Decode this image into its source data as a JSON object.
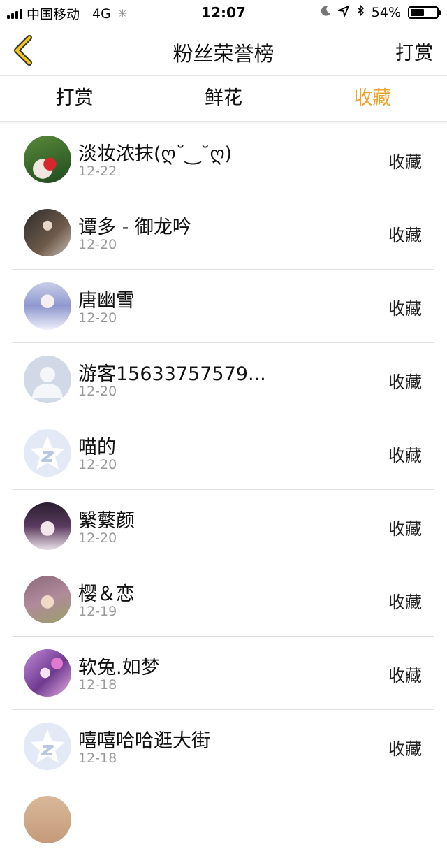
{
  "status_bar": {
    "carrier": "中国移动",
    "network": "4G",
    "time": "12:07",
    "battery": "54%",
    "battery_level": 0.54
  },
  "nav": {
    "title": "粉丝荣誉榜",
    "action": "打赏"
  },
  "tabs": [
    {
      "label": "打赏",
      "active": false
    },
    {
      "label": "鲜花",
      "active": false
    },
    {
      "label": "收藏",
      "active": true
    }
  ],
  "list": [
    {
      "name": "淡妆浓抹(ღ˘‿˘ღ)",
      "date": "12-22",
      "tag": "收藏",
      "avatar": "photo-red"
    },
    {
      "name": "谭多 - 御龙吟",
      "date": "12-20",
      "tag": "收藏",
      "avatar": "photo-dark"
    },
    {
      "name": "唐幽雪",
      "date": "12-20",
      "tag": "收藏",
      "avatar": "photo-blue"
    },
    {
      "name": "游客15633757579...",
      "date": "12-20",
      "tag": "收藏",
      "avatar": "default-person"
    },
    {
      "name": "喵的",
      "date": "12-20",
      "tag": "收藏",
      "avatar": "qq-logo"
    },
    {
      "name": "繄蘩颜",
      "date": "12-20",
      "tag": "收藏",
      "avatar": "photo-purple"
    },
    {
      "name": "樱＆恋",
      "date": "12-19",
      "tag": "收藏",
      "avatar": "photo-green"
    },
    {
      "name": "软兔.如梦",
      "date": "12-18",
      "tag": "收藏",
      "avatar": "photo-pink"
    },
    {
      "name": "嘻嘻哈哈逛大街",
      "date": "12-18",
      "tag": "收藏",
      "avatar": "qq-logo"
    }
  ],
  "colors": {
    "accent": "#f0a32a",
    "divider": "#e0e0e0",
    "date_text": "#9a9a9a"
  }
}
